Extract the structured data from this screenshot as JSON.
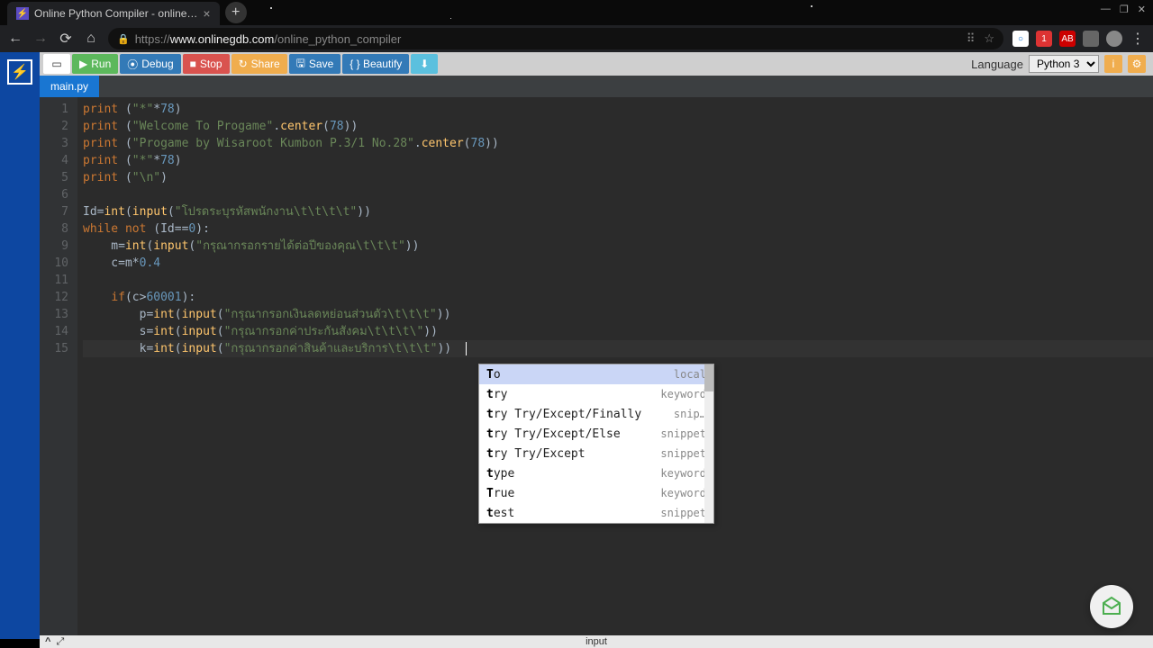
{
  "browser": {
    "tab_title": "Online Python Compiler - online…",
    "url_proto": "https://",
    "url_domain": "www.onlinegdb.com",
    "url_path": "/online_python_compiler",
    "wincontrols": {
      "min": "—",
      "max": "❐",
      "close": "✕"
    }
  },
  "toolbar": {
    "run": "Run",
    "debug": "Debug",
    "stop": "Stop",
    "share": "Share",
    "save": "Save",
    "beautify": "{ } Beautify",
    "lang_label": "Language",
    "lang_value": "Python 3"
  },
  "file_tab": "main.py",
  "code": {
    "lines": [
      {
        "n": 1,
        "seg": [
          [
            "ck",
            "print "
          ],
          [
            "co",
            "("
          ],
          [
            "cs",
            "\"*\""
          ],
          [
            "co",
            "*"
          ],
          [
            "cn",
            "78"
          ],
          [
            "co",
            ")"
          ]
        ]
      },
      {
        "n": 2,
        "seg": [
          [
            "ck",
            "print "
          ],
          [
            "co",
            "("
          ],
          [
            "cs",
            "\"Welcome To Progame\""
          ],
          [
            "co",
            "."
          ],
          [
            "cf",
            "center"
          ],
          [
            "co",
            "("
          ],
          [
            "cn",
            "78"
          ],
          [
            "co",
            "))"
          ]
        ]
      },
      {
        "n": 3,
        "seg": [
          [
            "ck",
            "print "
          ],
          [
            "co",
            "("
          ],
          [
            "cs",
            "\"Progame by Wisaroot Kumbon P.3/1 No.28\""
          ],
          [
            "co",
            "."
          ],
          [
            "cf",
            "center"
          ],
          [
            "co",
            "("
          ],
          [
            "cn",
            "78"
          ],
          [
            "co",
            "))"
          ]
        ]
      },
      {
        "n": 4,
        "seg": [
          [
            "ck",
            "print "
          ],
          [
            "co",
            "("
          ],
          [
            "cs",
            "\"*\""
          ],
          [
            "co",
            "*"
          ],
          [
            "cn",
            "78"
          ],
          [
            "co",
            ")"
          ]
        ]
      },
      {
        "n": 5,
        "seg": [
          [
            "ck",
            "print "
          ],
          [
            "co",
            "("
          ],
          [
            "cs",
            "\"\\n\""
          ],
          [
            "co",
            ")"
          ]
        ]
      },
      {
        "n": 6,
        "seg": []
      },
      {
        "n": 7,
        "seg": [
          [
            "co",
            "Id"
          ],
          [
            "co",
            "="
          ],
          [
            "cf",
            "int"
          ],
          [
            "co",
            "("
          ],
          [
            "cf",
            "input"
          ],
          [
            "co",
            "("
          ],
          [
            "cs",
            "\"โปรดระบุรหัสพนักงาน\\t\\t\\t\\t\""
          ],
          [
            "co",
            "))"
          ]
        ]
      },
      {
        "n": 8,
        "seg": [
          [
            "ck",
            "while not "
          ],
          [
            "co",
            "(Id=="
          ],
          [
            "cn",
            "0"
          ],
          [
            "co",
            "):"
          ]
        ]
      },
      {
        "n": 9,
        "seg": [
          [
            "co",
            "    m="
          ],
          [
            "cf",
            "int"
          ],
          [
            "co",
            "("
          ],
          [
            "cf",
            "input"
          ],
          [
            "co",
            "("
          ],
          [
            "cs",
            "\"กรุณากรอกรายได้ต่อปีของคุณ\\t\\t\\t\""
          ],
          [
            "co",
            "))"
          ]
        ]
      },
      {
        "n": 10,
        "seg": [
          [
            "co",
            "    c=m*"
          ],
          [
            "cn",
            "0.4"
          ]
        ]
      },
      {
        "n": 11,
        "seg": []
      },
      {
        "n": 12,
        "seg": [
          [
            "co",
            "    "
          ],
          [
            "ck",
            "if"
          ],
          [
            "co",
            "(c>"
          ],
          [
            "cn",
            "60001"
          ],
          [
            "co",
            "):"
          ]
        ]
      },
      {
        "n": 13,
        "seg": [
          [
            "co",
            "        p="
          ],
          [
            "cf",
            "int"
          ],
          [
            "co",
            "("
          ],
          [
            "cf",
            "input"
          ],
          [
            "co",
            "("
          ],
          [
            "cs",
            "\"กรุณากรอกเงินลดหย่อนส่วนตัว\\t\\t\\t\""
          ],
          [
            "co",
            "))"
          ]
        ]
      },
      {
        "n": 14,
        "seg": [
          [
            "co",
            "        s="
          ],
          [
            "cf",
            "int"
          ],
          [
            "co",
            "("
          ],
          [
            "cf",
            "input"
          ],
          [
            "co",
            "("
          ],
          [
            "cs",
            "\"กรุณากรอกค่าประกันสังคม\\t\\t\\t\\\""
          ],
          [
            "co",
            "))"
          ]
        ]
      },
      {
        "n": 15,
        "seg": [
          [
            "co",
            "        k="
          ],
          [
            "cf",
            "int"
          ],
          [
            "co",
            "("
          ],
          [
            "cf",
            "input"
          ],
          [
            "co",
            "("
          ],
          [
            "cs",
            "\"กรุณากรอกค่าสินค้าและบริการ\\t\\t\\t\""
          ],
          [
            "co",
            "))  "
          ]
        ],
        "cursor": true,
        "hl": true
      }
    ]
  },
  "autocomplete": {
    "items": [
      {
        "prefix": "T",
        "rest": "o",
        "kind": "local",
        "selected": true
      },
      {
        "prefix": "t",
        "rest": "ry",
        "kind": "keyword"
      },
      {
        "prefix": "t",
        "rest": "ry Try/Except/Finally",
        "kind": "snip…"
      },
      {
        "prefix": "t",
        "rest": "ry Try/Except/Else",
        "kind": "snippet"
      },
      {
        "prefix": "t",
        "rest": "ry Try/Except",
        "kind": "snippet"
      },
      {
        "prefix": "t",
        "rest": "ype",
        "kind": "keyword"
      },
      {
        "prefix": "T",
        "rest": "rue",
        "kind": "keyword"
      },
      {
        "prefix": "t",
        "rest": "est",
        "kind": "snippet"
      }
    ]
  },
  "bottombar": {
    "label": "input"
  }
}
